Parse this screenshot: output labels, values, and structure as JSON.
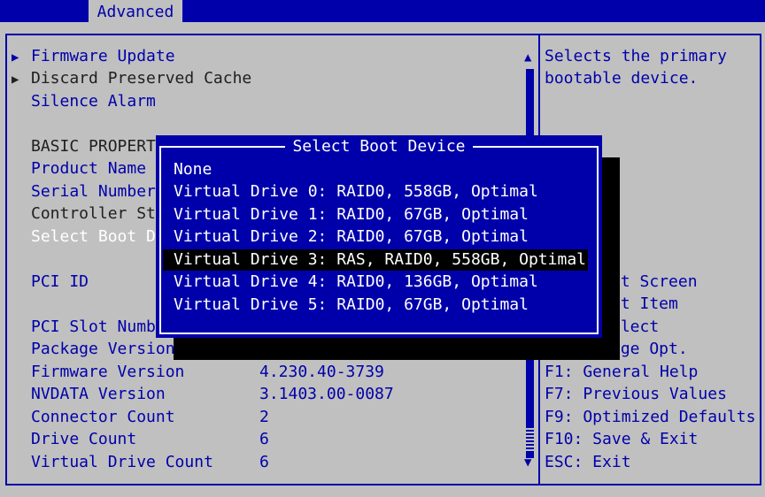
{
  "tab": {
    "label": "Advanced"
  },
  "menu": {
    "firmware_update": "Firmware Update",
    "discard_cache": "Discard Preserved Cache",
    "silence_alarm": "Silence Alarm",
    "basic_properties": "BASIC PROPERT",
    "product_name": "Product Name",
    "serial_number": "Serial Number",
    "controller_status": "Controller St",
    "select_boot": "Select Boot D",
    "pci_id": "PCI ID",
    "pci_slot": "PCI Slot Numb",
    "package_version": "Package Version",
    "firmware_version": {
      "label": "Firmware Version",
      "value": "4.230.40-3739"
    },
    "nvdata_version": {
      "label": "NVDATA Version",
      "value": "3.1403.00-0087"
    },
    "connector_count": {
      "label": "Connector Count",
      "value": "2"
    },
    "drive_count": {
      "label": "Drive Count",
      "value": "6"
    },
    "virtual_drive_count": {
      "label": "Virtual Drive Count",
      "value": "6"
    }
  },
  "help": {
    "line1": "Selects the primary",
    "line2": "bootable device.",
    "k1": "ct Screen",
    "k2": "ct Item",
    "k3": "elect",
    "k4": "nge Opt.",
    "f1": "F1: General Help",
    "f7": "F7: Previous Values",
    "f9": "F9: Optimized Defaults",
    "f10": "F10: Save & Exit",
    "esc": "ESC: Exit"
  },
  "dialog": {
    "title": "Select Boot Device",
    "options": [
      "None",
      "Virtual Drive 0: RAID0, 558GB, Optimal",
      "Virtual Drive 1: RAID0, 67GB, Optimal",
      "Virtual Drive 2: RAID0, 67GB, Optimal",
      "Virtual Drive 3: RAS, RAID0, 558GB, Optimal",
      "Virtual Drive 4: RAID0, 136GB, Optimal",
      "Virtual Drive 5: RAID0, 67GB, Optimal"
    ],
    "selected_index": 4
  },
  "colors": {
    "background": "#c0c0c0",
    "accent": "#0000aa",
    "highlight": "#000000",
    "text_light": "#ffffff"
  }
}
